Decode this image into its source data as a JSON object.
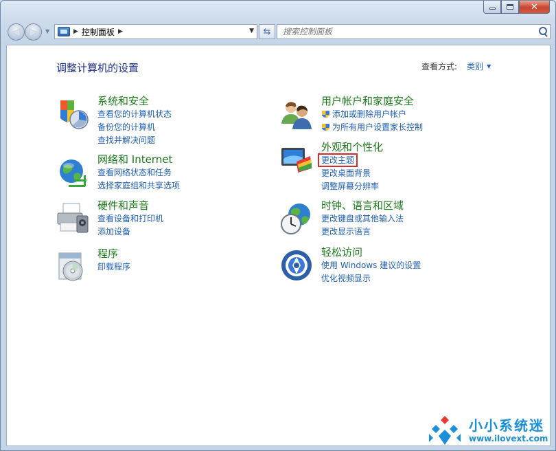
{
  "window": {
    "minimize_icon": "minimize-icon",
    "maximize_icon": "maximize-icon",
    "close_icon": "close-icon"
  },
  "navbar": {
    "back_icon": "back-arrow-icon",
    "forward_icon": "forward-arrow-icon",
    "breadcrumb": [
      "控制面板"
    ],
    "search_placeholder": "搜索控制面板"
  },
  "main": {
    "title": "调整计算机的设置",
    "view_by_label": "查看方式:",
    "view_by_value": "类别",
    "left_categories": [
      {
        "title": "系统和安全",
        "icon": "system-security-icon",
        "links": [
          "查看您的计算机状态",
          "备份您的计算机",
          "查找并解决问题"
        ]
      },
      {
        "title": "网络和 Internet",
        "icon": "network-globe-icon",
        "links": [
          "查看网络状态和任务",
          "选择家庭组和共享选项"
        ]
      },
      {
        "title": "硬件和声音",
        "icon": "printer-icon",
        "links": [
          "查看设备和打印机",
          "添加设备"
        ]
      },
      {
        "title": "程序",
        "icon": "programs-disc-icon",
        "links": [
          "卸载程序"
        ]
      }
    ],
    "right_categories": [
      {
        "title": "用户帐户和家庭安全",
        "icon": "users-icon",
        "links": [
          "添加或删除用户帐户",
          "为所有用户设置家长控制"
        ]
      },
      {
        "title": "外观和个性化",
        "icon": "appearance-monitor-icon",
        "links": [
          "更改主题",
          "更改桌面背景",
          "调整屏幕分辨率"
        ]
      },
      {
        "title": "时钟、语言和区域",
        "icon": "clock-globe-icon",
        "links": [
          "更改键盘或其他输入法",
          "更改显示语言"
        ]
      },
      {
        "title": "轻松访问",
        "icon": "ease-of-access-icon",
        "links": [
          "使用 Windows 建议的设置",
          "优化视频显示"
        ]
      }
    ]
  },
  "watermark": {
    "name": "小小系统迷",
    "url": "www.ilovext.com"
  },
  "colors": {
    "category_title": "#1a7a1a",
    "link": "#1f5fb5",
    "page_title": "#1e3287",
    "highlight_box": "#d62b2b"
  }
}
